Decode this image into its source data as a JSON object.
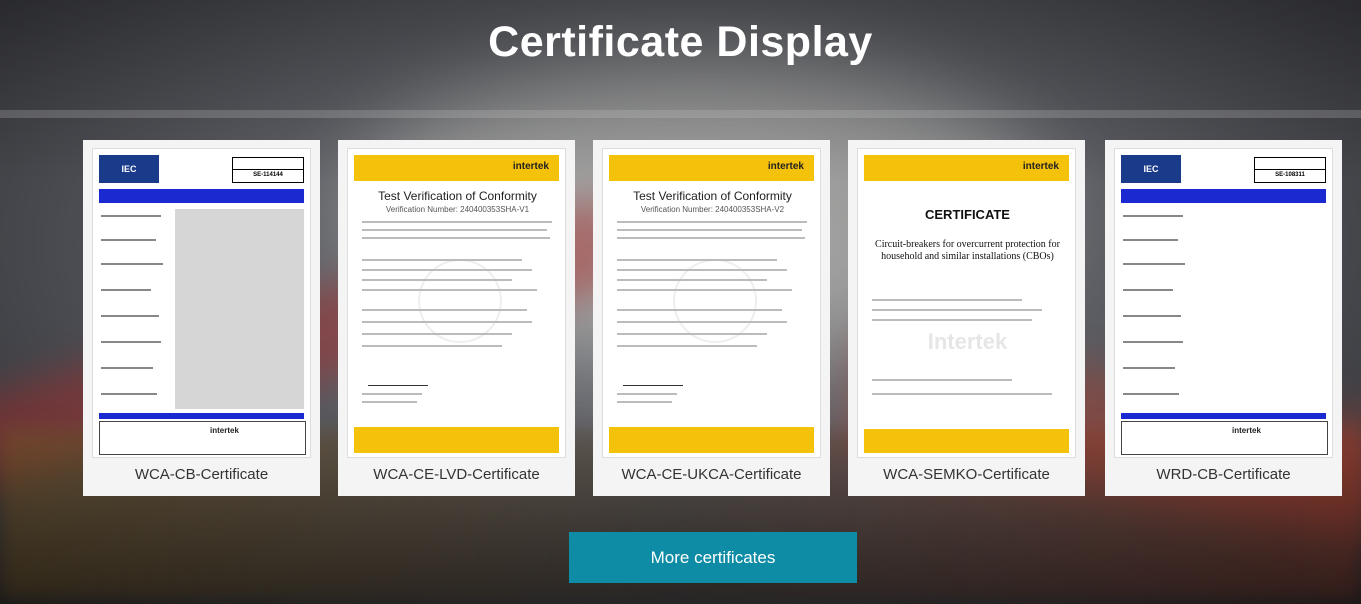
{
  "section": {
    "title": "Certificate Display",
    "more_button": "More certificates"
  },
  "certificates": [
    {
      "caption": "WCA-CB-Certificate",
      "kind": "iec",
      "ref": "SE-114144",
      "issuer": "intertek"
    },
    {
      "caption": "WCA-CE-LVD-Certificate",
      "kind": "intertek",
      "doc_title": "Test Verification of Conformity",
      "verification": "Verification Number: 240400353SHA-V1"
    },
    {
      "caption": "WCA-CE-UKCA-Certificate",
      "kind": "intertek",
      "doc_title": "Test Verification of Conformity",
      "verification": "Verification Number: 240400353SHA-V2"
    },
    {
      "caption": "WCA-SEMKO-Certificate",
      "kind": "semko",
      "doc_title": "CERTIFICATE",
      "subject": "Circuit-breakers for overcurrent protection for household and similar installations (CBOs)"
    },
    {
      "caption": "WRD-CB-Certificate",
      "kind": "iec",
      "ref": "SE-108311",
      "issuer": "intertek"
    }
  ],
  "colors": {
    "button_bg": "#0e8ca6",
    "band_yellow": "#f5c20b",
    "iec_blue": "#1a2ad0"
  },
  "icons": {
    "iec_logo": "iec-logo-icon",
    "intertek_logo": "intertek-logo-icon"
  }
}
